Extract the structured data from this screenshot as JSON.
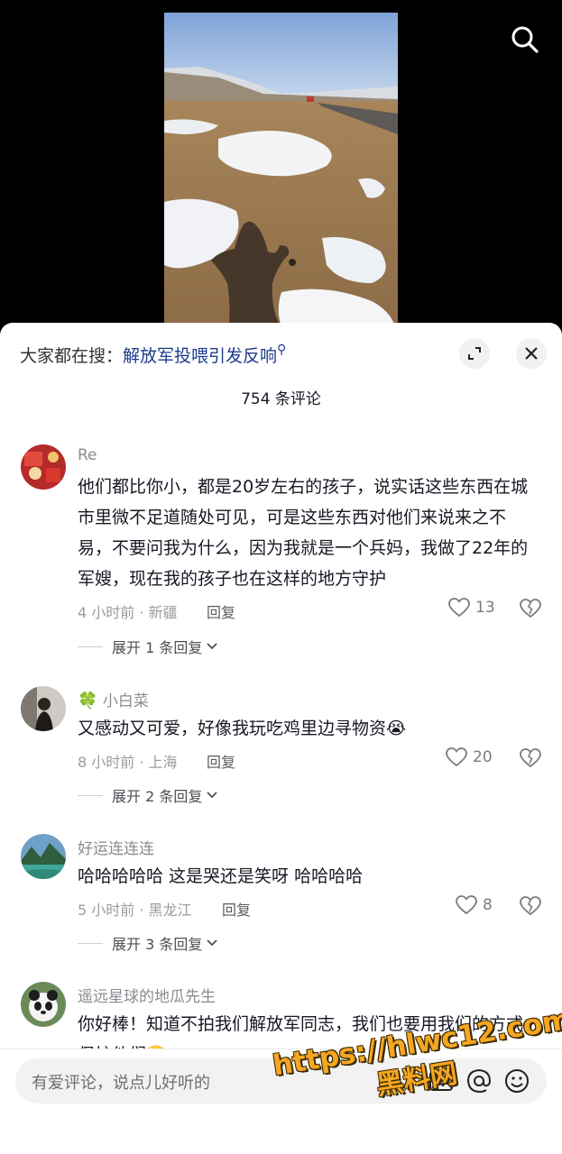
{
  "colors": {
    "keyword": "#1e3c8c",
    "meta": "#9b9ca1",
    "text": "#161823"
  },
  "header": {
    "search_prefix": "大家都在搜：",
    "search_keyword": "解放军投喂引发反响",
    "comment_count": "754 条评论"
  },
  "comments": [
    {
      "name": "Re",
      "text": "他们都比你小，都是20岁左右的孩子，说实话这些东西在城市里微不足道随处可见，可是这些东西对他们来说来之不易，不要问我为什么，因为我就是一个兵妈，我做了22年的军嫂，现在我的孩子也在这样的地方守护",
      "meta": "4 小时前 · 新疆",
      "reply": "回复",
      "likes": "13",
      "expand": "展开 1 条回复"
    },
    {
      "name": "小白菜",
      "text": "又感动又可爱，好像我玩吃鸡里边寻物资😭",
      "meta": "8 小时前 · 上海",
      "reply": "回复",
      "likes": "20",
      "expand": "展开 2 条回复"
    },
    {
      "name": "好运连连连",
      "text": "哈哈哈哈哈 这是哭还是笑呀 哈哈哈哈",
      "meta": "5 小时前 · 黑龙江",
      "reply": "回复",
      "likes": "8",
      "expand": "展开 3 条回复"
    },
    {
      "name": "遥远星球的地瓜先生",
      "text": "你好棒！知道不拍我们解放军同志，我们也要用我们的方式保护他们🫡"
    }
  ],
  "input": {
    "placeholder": "有爱评论，说点儿好听的"
  },
  "watermark": {
    "url": "https://hlwc12.com",
    "name": "黑料网"
  },
  "icons": [
    "search-icon",
    "expand-icon",
    "close-icon",
    "heart-icon",
    "broken-heart-icon",
    "chevron-down-icon",
    "at-icon",
    "emoji-icon",
    "image-icon"
  ]
}
